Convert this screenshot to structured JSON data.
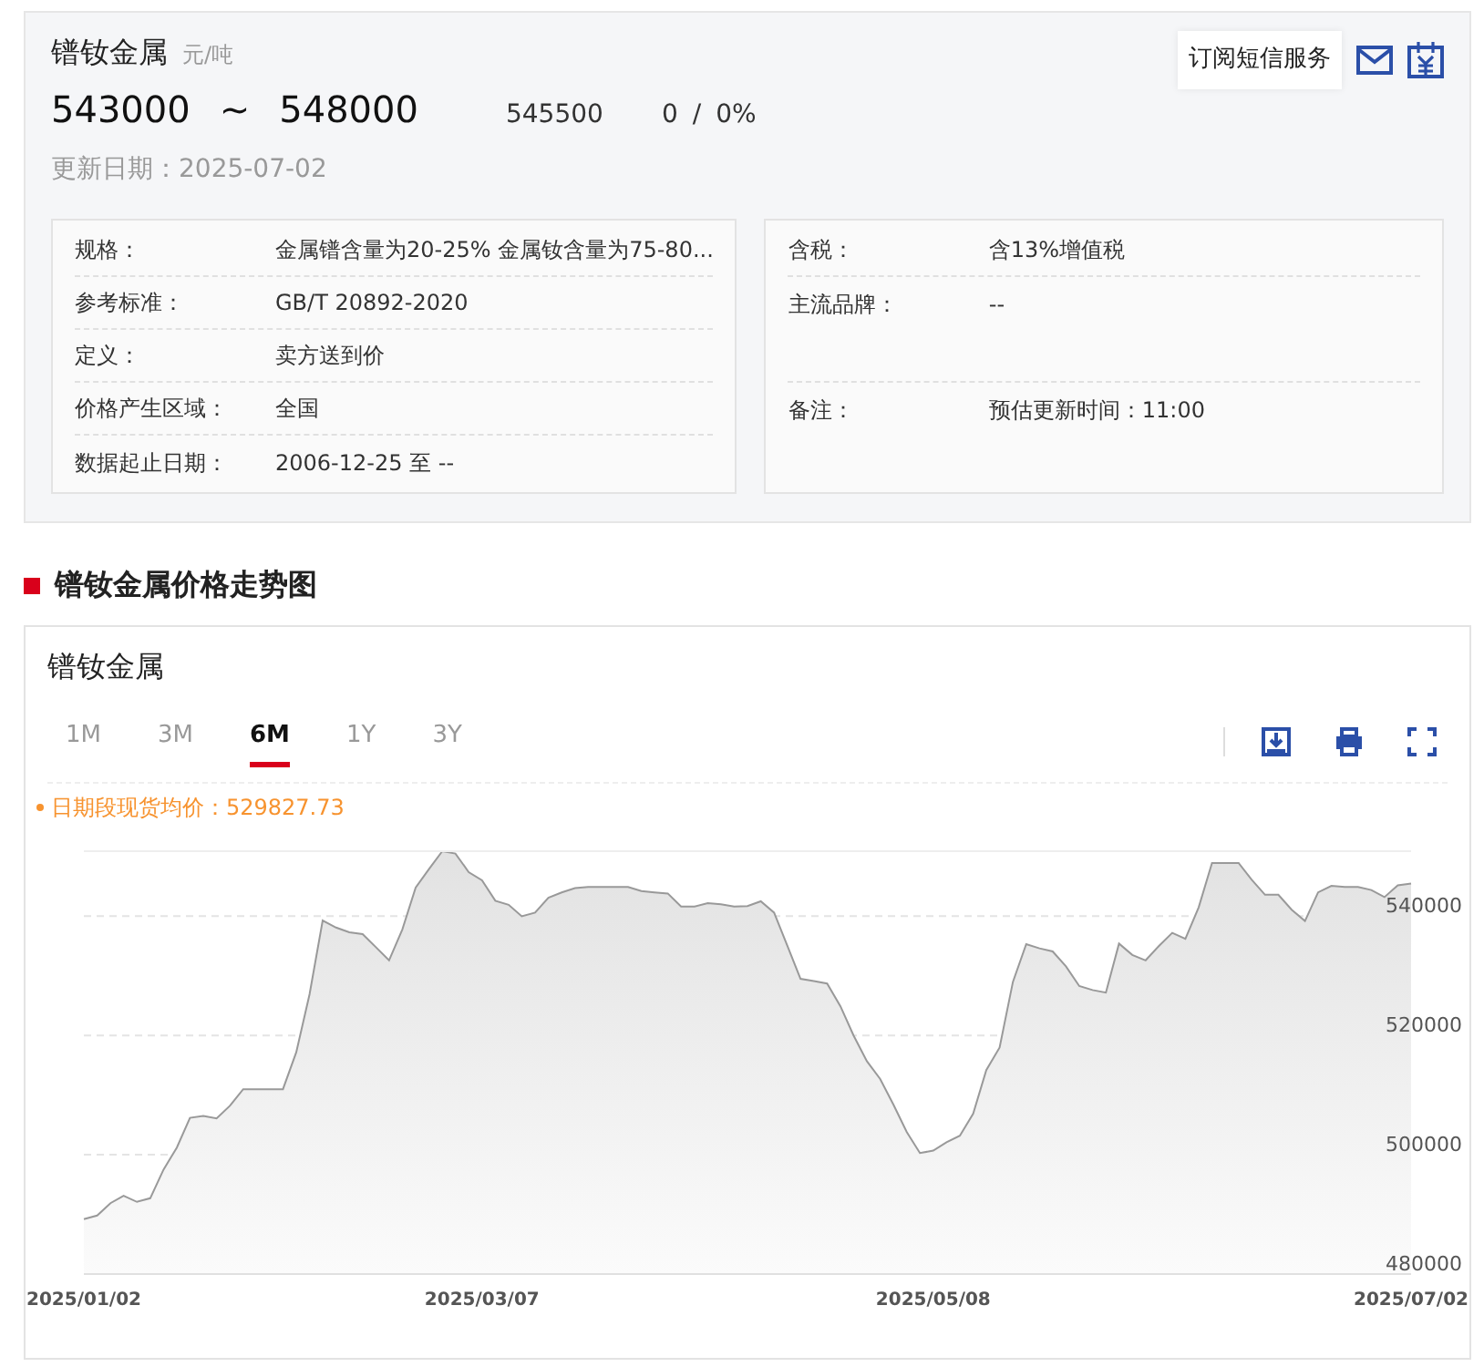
{
  "header": {
    "title": "镨钕金属",
    "unit": "元/吨",
    "low": "543000",
    "range_separator": "~",
    "high": "548000",
    "average": "545500",
    "change": "0",
    "change_separator": "/",
    "change_pct": "0%",
    "updated": "更新日期：2025-07-02",
    "subscribe": "订阅短信服务"
  },
  "specs_left": [
    {
      "label": "规格：",
      "value": "金属镨含量为20-25% 金属钕含量为75-80..."
    },
    {
      "label": "参考标准：",
      "value": "GB/T 20892-2020"
    },
    {
      "label": "定义：",
      "value": "卖方送到价"
    },
    {
      "label": "价格产生区域：",
      "value": "全国"
    },
    {
      "label": "数据起止日期：",
      "value": "2006-12-25 至 --"
    }
  ],
  "specs_right": [
    {
      "label": "含税：",
      "value": "含13%增值税"
    },
    {
      "label": "主流品牌：",
      "value": "--"
    },
    {
      "label": "备注：",
      "value": "预估更新时间：11:00"
    }
  ],
  "section_title": "镨钕金属价格走势图",
  "chart_card": {
    "title": "镨钕金属",
    "ranges": [
      {
        "label": "1M",
        "selected": false
      },
      {
        "label": "3M",
        "selected": false
      },
      {
        "label": "6M",
        "selected": true
      },
      {
        "label": "1Y",
        "selected": false
      },
      {
        "label": "3Y",
        "selected": false
      }
    ],
    "average_note": "日期段现货均价：529827.73",
    "chart_data": {
      "type": "area",
      "grid": true,
      "ylim": [
        480000,
        550900
      ],
      "yticks": [
        480000,
        500000,
        520000,
        540000
      ],
      "categories": [
        "2025/01/02",
        null,
        null,
        null,
        null,
        null,
        null,
        null,
        null,
        null,
        null,
        null,
        null,
        null,
        null,
        null,
        null,
        null,
        null,
        null,
        null,
        null,
        null,
        null,
        null,
        null,
        null,
        null,
        null,
        null,
        "2025/03/07",
        null,
        null,
        null,
        null,
        null,
        null,
        null,
        null,
        null,
        null,
        null,
        null,
        null,
        null,
        null,
        null,
        null,
        null,
        null,
        null,
        null,
        null,
        null,
        null,
        null,
        null,
        null,
        null,
        null,
        null,
        null,
        null,
        null,
        "2025/05/08",
        null,
        null,
        null,
        null,
        null,
        null,
        null,
        null,
        null,
        null,
        null,
        null,
        null,
        null,
        null,
        null,
        null,
        null,
        null,
        null,
        null,
        null,
        null,
        null,
        null,
        null,
        null,
        null,
        null,
        null,
        null,
        null,
        null,
        null,
        null,
        "2025/07/02"
      ],
      "series": [
        {
          "color": "#999999",
          "values": [
            489200,
            489800,
            491900,
            493100,
            492100,
            492700,
            497500,
            501200,
            506200,
            506500,
            506100,
            508200,
            511000,
            511000,
            511000,
            511000,
            517200,
            526900,
            539300,
            538100,
            537300,
            537000,
            534800,
            532600,
            537800,
            544800,
            547900,
            550900,
            550500,
            547400,
            546000,
            542600,
            541900,
            540000,
            540600,
            543100,
            544000,
            544700,
            544900,
            544900,
            544900,
            544900,
            544200,
            544000,
            543800,
            541600,
            541600,
            542200,
            542000,
            541600,
            541700,
            542500,
            540600,
            535100,
            529500,
            529100,
            528700,
            524900,
            520000,
            515700,
            512700,
            508400,
            503800,
            500300,
            500700,
            502100,
            503200,
            506900,
            514200,
            518000,
            529000,
            535300,
            534600,
            534100,
            531600,
            528300,
            527600,
            527200,
            535400,
            533500,
            532600,
            535000,
            537200,
            536200,
            541500,
            548900,
            548900,
            548900,
            546100,
            543600,
            543600,
            541100,
            539200,
            544000,
            545100,
            544900,
            544900,
            544400,
            543200,
            545200,
            545500
          ]
        }
      ]
    }
  }
}
